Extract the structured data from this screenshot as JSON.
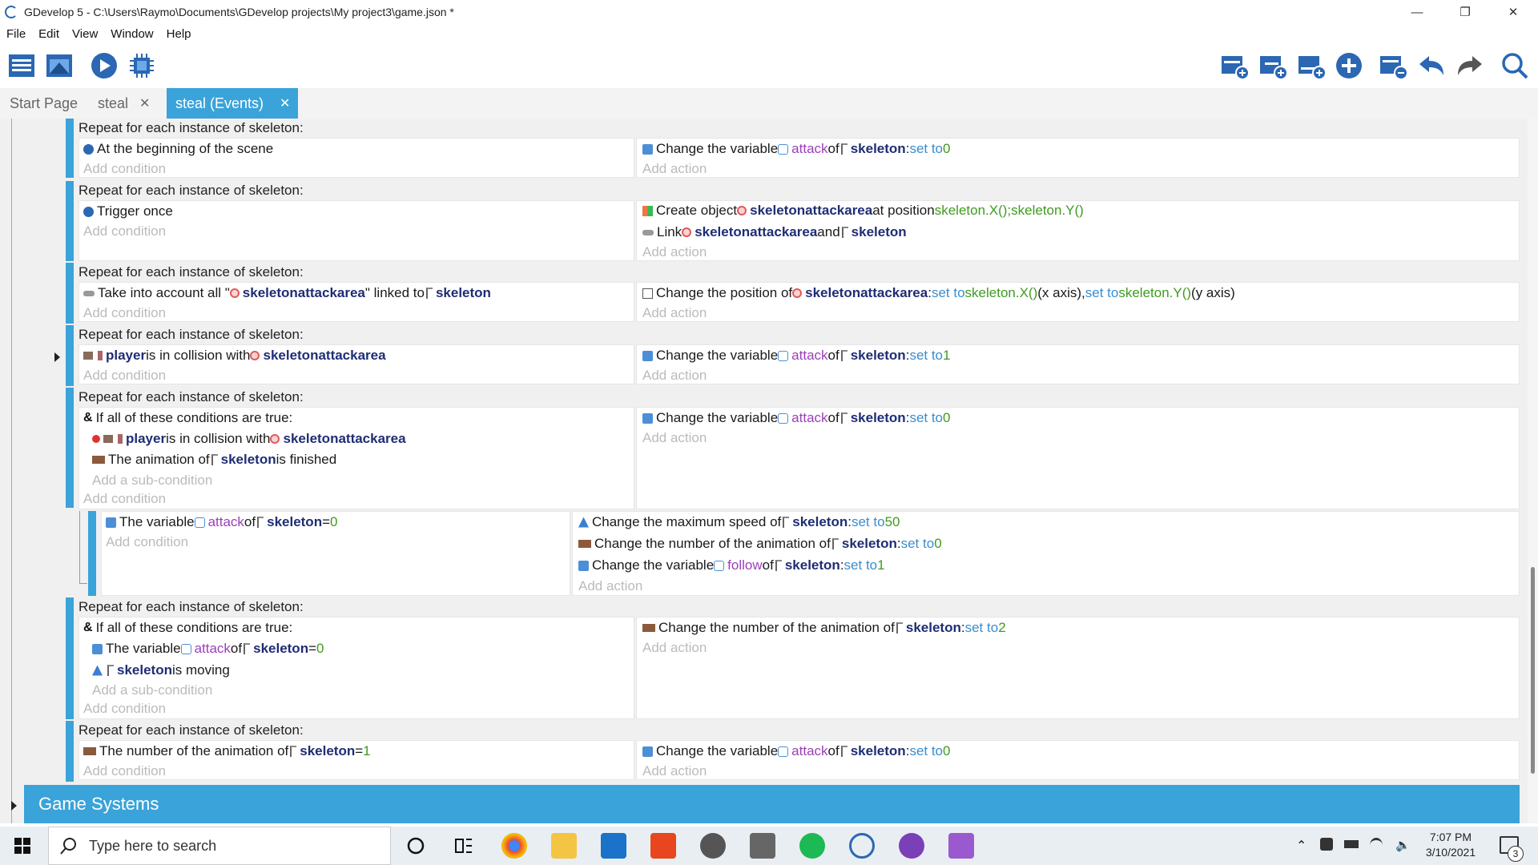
{
  "window": {
    "title": "GDevelop 5 - C:\\Users\\Raymo\\Documents\\GDevelop projects\\My project3\\game.json *",
    "minimize": "—",
    "restore": "❐",
    "close": "✕"
  },
  "menu": [
    "File",
    "Edit",
    "View",
    "Window",
    "Help"
  ],
  "toolbar_icons": [
    "project-manager-icon",
    "scene-editor-icon",
    "preview-play-icon",
    "debugger-icon",
    "add-event-icon",
    "add-subevent-icon",
    "add-other-icon",
    "add-extension-icon",
    "delete-icon",
    "undo-icon",
    "redo-icon",
    "search-icon"
  ],
  "tabs": [
    {
      "label": "Start Page",
      "closable": false
    },
    {
      "label": "steal",
      "closable": true
    },
    {
      "label": "steal (Events)",
      "closable": true,
      "active": true
    }
  ],
  "common": {
    "repeat": "Repeat for each instance of skeleton:",
    "add_condition": "Add condition",
    "add_action": "Add action",
    "add_subcondition": "Add a sub-condition"
  },
  "events": {
    "e1": {
      "cond": "At the beginning of the scene",
      "a1": {
        "pre": "Change the variable ",
        "var": "attack",
        "of": " of ",
        "obj": "skeleton",
        "colon": ": ",
        "set": "set to ",
        "val": "0"
      }
    },
    "e2": {
      "cond": "Trigger once",
      "a1": {
        "pre": "Create object ",
        "obj": "skeletonattackarea",
        "mid": " at position ",
        "expr": "skeleton.X();skeleton.Y()"
      },
      "a2": {
        "pre": "Link ",
        "obj1": "skeletonattackarea",
        "and": " and ",
        "obj2": "skeleton"
      }
    },
    "e3": {
      "c1": {
        "pre": "Take into account all \"",
        "obj1": "skeletonattackarea",
        "mid": "\" linked to ",
        "obj2": "skeleton"
      },
      "a1": {
        "pre": "Change the position of ",
        "obj": "skeletonattackarea",
        "colon": ": ",
        "set1": "set to ",
        "x": "skeleton.X()",
        "xaxis": " (x axis), ",
        "set2": "set to ",
        "y": "skeleton.Y()",
        "yaxis": " (y axis)"
      }
    },
    "e4": {
      "c1": {
        "obj1": "player",
        "mid": " is in collision with ",
        "obj2": "skeletonattackarea"
      },
      "a1": {
        "pre": "Change the variable ",
        "var": "attack",
        "of": " of ",
        "obj": "skeleton",
        "colon": ": ",
        "set": "set to ",
        "val": "1"
      }
    },
    "e5": {
      "or": "If all of these conditions are true:",
      "s1": {
        "obj1": "player",
        "mid": " is in collision with ",
        "obj2": "skeletonattackarea"
      },
      "s2": {
        "pre": "The animation of ",
        "obj": "skeleton",
        "post": " is finished"
      },
      "a1": {
        "pre": "Change the variable ",
        "var": "attack",
        "of": " of ",
        "obj": "skeleton",
        "colon": ": ",
        "set": "set to ",
        "val": "0"
      }
    },
    "e5sub": {
      "c1": {
        "pre": "The variable ",
        "var": "attack",
        "of": " of ",
        "obj": "skeleton",
        "op": " = ",
        "val": "0"
      },
      "a1": {
        "pre": "Change the maximum speed of ",
        "obj": "skeleton",
        "colon": ": ",
        "set": "set to ",
        "val": "50"
      },
      "a2": {
        "pre": "Change the number of the animation of ",
        "obj": "skeleton",
        "colon": ": ",
        "set": "set to ",
        "val": "0"
      },
      "a3": {
        "pre": "Change the variable ",
        "var": "follow",
        "of": " of ",
        "obj": "skeleton",
        "colon": ": ",
        "set": "set to ",
        "val": "1"
      }
    },
    "e6": {
      "or": "If all of these conditions are true:",
      "s1": {
        "pre": "The variable ",
        "var": "attack",
        "of": " of ",
        "obj": "skeleton",
        "op": " = ",
        "val": "0"
      },
      "s2": {
        "obj": "skeleton",
        "post": " is moving"
      },
      "a1": {
        "pre": "Change the number of the animation of ",
        "obj": "skeleton",
        "colon": ": ",
        "set": "set to ",
        "val": "2"
      }
    },
    "e7": {
      "c1": {
        "pre": "The number of the animation of ",
        "obj": "skeleton",
        "op": " = ",
        "val": "1"
      },
      "a1": {
        "pre": "Change the variable ",
        "var": "attack",
        "of": " of ",
        "obj": "skeleton",
        "colon": ": ",
        "set": "set to ",
        "val": "0"
      }
    }
  },
  "game_systems": "Game Systems",
  "taskbar": {
    "search_placeholder": "Type here to search",
    "time": "7:07 PM",
    "date": "3/10/2021",
    "notifications": "3"
  }
}
